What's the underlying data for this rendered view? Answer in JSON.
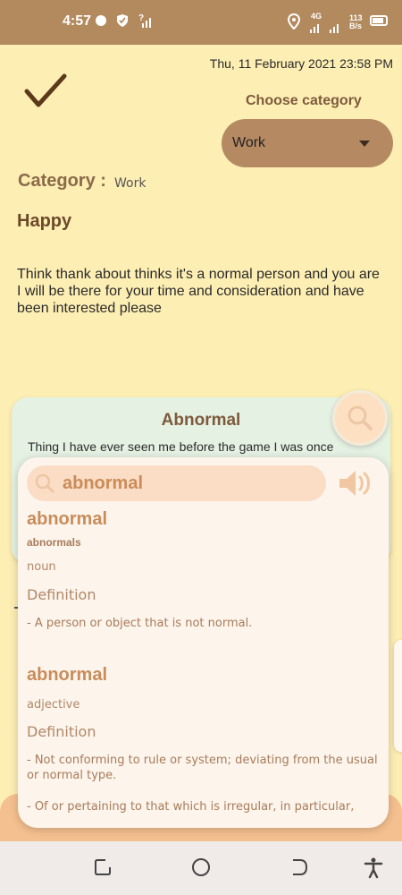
{
  "status_bar": {
    "time": "4:57",
    "network_label": "4G",
    "speed_value": "113",
    "speed_unit": "B/s",
    "icons": [
      "whatsapp-icon",
      "shield-icon",
      "signal-unknown-icon",
      "location-icon",
      "signal-icon",
      "battery-icon"
    ]
  },
  "note": {
    "date": "Thu, 11 February 2021 23:58 PM",
    "choose_category_label": "Choose category",
    "selected_category": "Work",
    "category_label": "Category :",
    "category_value": "Work",
    "title": "Happy",
    "body": "Think thank about thinks it's a normal person and you are I will be there for your time and consideration and have been interested please"
  },
  "back_card": {
    "title": "Abnormal",
    "text": "Thing I have ever seen me before the game I was once"
  },
  "dictionary": {
    "query": "abnormal",
    "entries": [
      {
        "word": "abnormal",
        "plural": "abnormals",
        "pos": "noun",
        "definition_label": "Definition",
        "definitions": [
          "- A person or object that is not normal."
        ]
      },
      {
        "word": "abnormal",
        "pos": "adjective",
        "definition_label": "Definition",
        "definitions": [
          "- Not conforming to rule or system; deviating from the usual or normal type.",
          "- Of or pertaining to that which is irregular, in particular,"
        ]
      }
    ]
  },
  "colors": {
    "status_bar": "#b38a5e",
    "background": "#fdeeb3",
    "accent_brown": "#7d5a3c",
    "dropdown": "#b58a63",
    "card_green": "#e5f1e3",
    "popup": "#fdf4ec",
    "dict_text": "#c98c5a"
  }
}
